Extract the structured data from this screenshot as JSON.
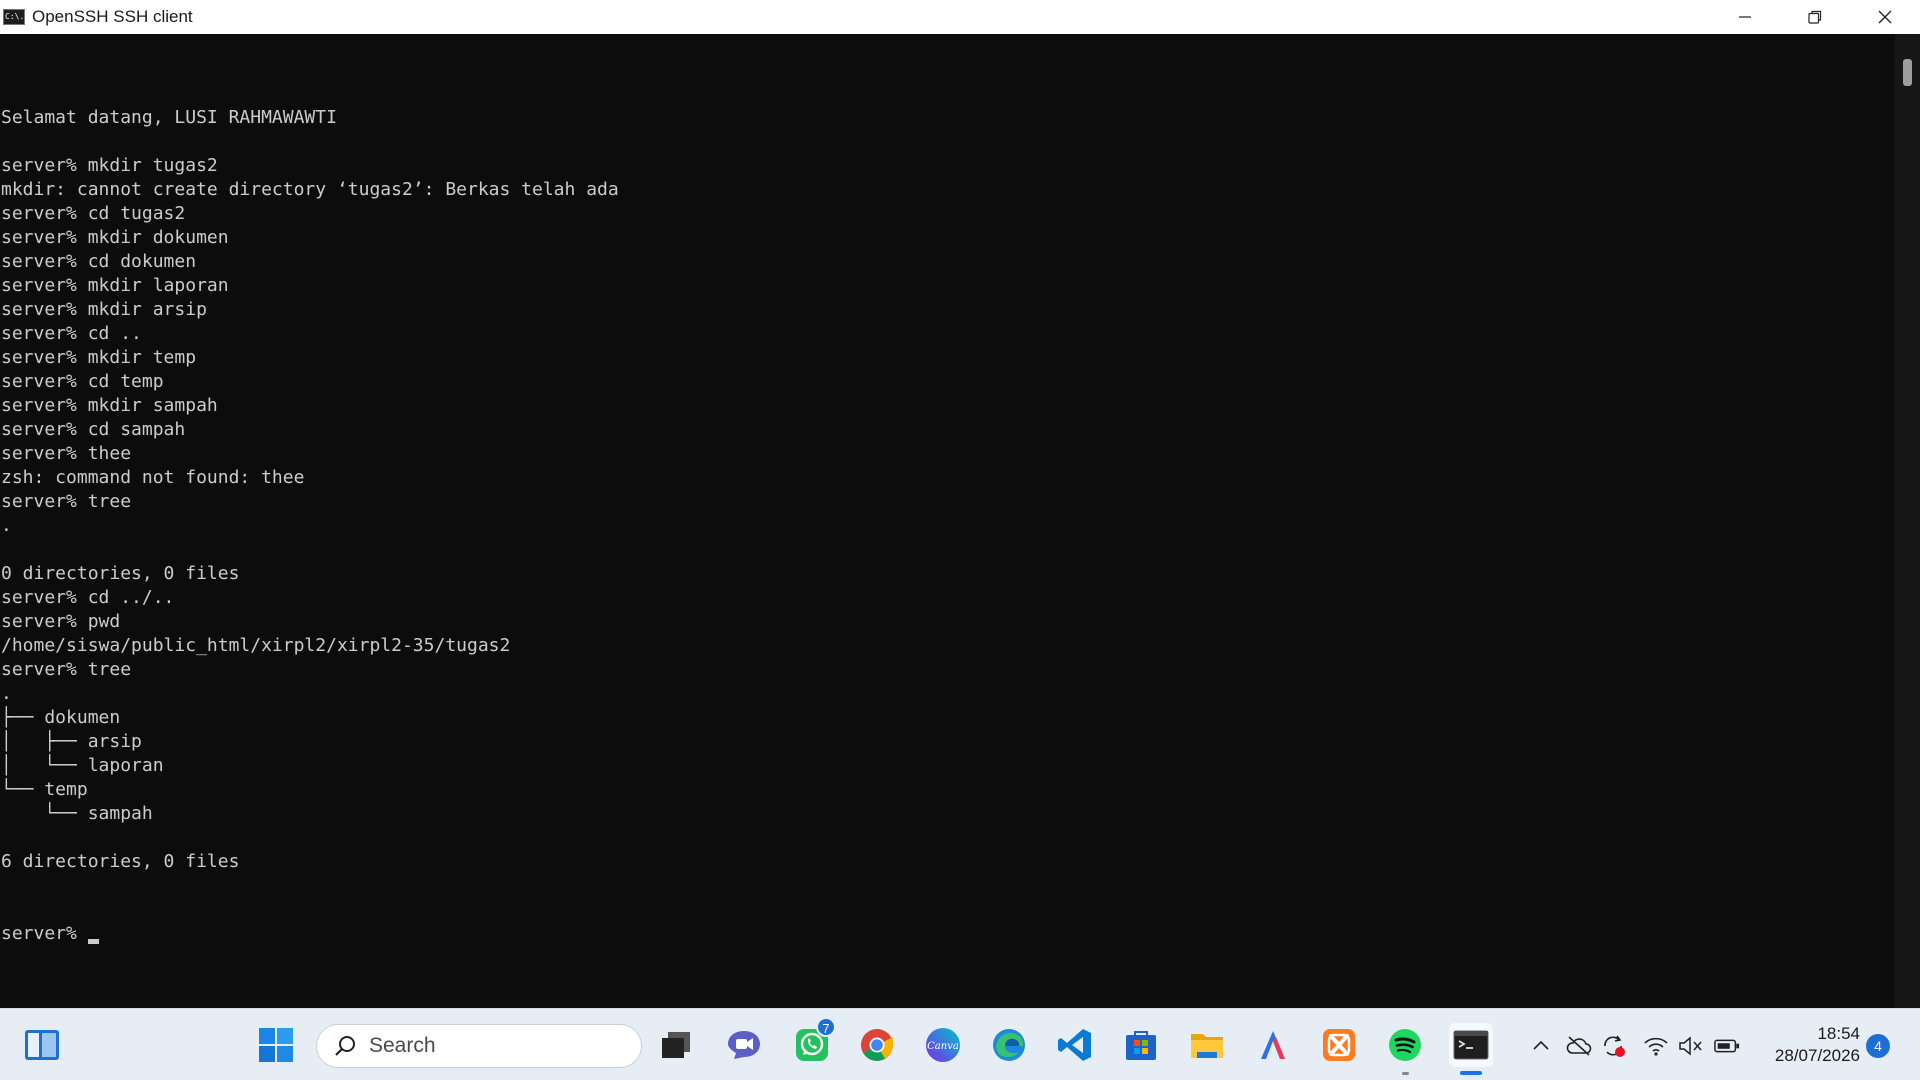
{
  "window": {
    "title": "OpenSSH SSH client",
    "app_icon_text": "C:\\."
  },
  "terminal": {
    "lines": [
      "Selamat datang, LUSI RAHMAWAWTI",
      "",
      "server% mkdir tugas2",
      "mkdir: cannot create directory ‘tugas2’: Berkas telah ada",
      "server% cd tugas2",
      "server% mkdir dokumen",
      "server% cd dokumen",
      "server% mkdir laporan",
      "server% mkdir arsip",
      "server% cd ..",
      "server% mkdir temp",
      "server% cd temp",
      "server% mkdir sampah",
      "server% cd sampah",
      "server% thee",
      "zsh: command not found: thee",
      "server% tree",
      ".",
      "",
      "0 directories, 0 files",
      "server% cd ../..",
      "server% pwd",
      "/home/siswa/public_html/xirpl2/xirpl2-35/tugas2",
      "server% tree",
      ".",
      "├── dokumen",
      "│   ├── arsip",
      "│   └── laporan",
      "└── temp",
      "    └── sampah",
      "",
      "6 directories, 0 files"
    ],
    "prompt": "server% "
  },
  "taskbar": {
    "search_placeholder": "Search",
    "whatsapp_badge": "7",
    "canva_label": "Canva",
    "time": "18:54",
    "date": "28/07/2026",
    "notification_count": "4"
  },
  "icons": {
    "start": "windows-start-icon",
    "search": "search-icon",
    "task_view": "task-view-icon",
    "teams": "teams-icon",
    "whatsapp": "whatsapp-icon",
    "chrome": "chrome-icon",
    "canva": "canva-icon",
    "edge": "edge-icon",
    "vscode": "vscode-icon",
    "store": "microsoft-store-icon",
    "explorer": "file-explorer-icon",
    "arc": "app-a-icon",
    "xampp": "xampp-icon",
    "spotify": "spotify-icon",
    "terminal": "terminal-icon"
  },
  "colors": {
    "terminal_bg": "#0c0c0c",
    "terminal_fg": "#cccccc",
    "taskbar_bg": "#e7edf5",
    "accent": "#1a73e8"
  }
}
